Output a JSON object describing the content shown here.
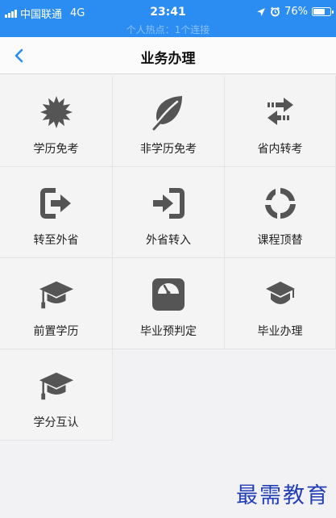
{
  "status": {
    "carrier": "中国联通",
    "network": "4G",
    "time": "23:41",
    "battery": "76%",
    "battery_level": 0.76,
    "hotspot": "个人热点：1个连接"
  },
  "nav": {
    "title": "业务办理"
  },
  "grid": {
    "items": [
      {
        "label": "学历免考",
        "icon": "starburst-icon"
      },
      {
        "label": "非学历免考",
        "icon": "leaf-icon"
      },
      {
        "label": "省内转考",
        "icon": "swap-arrows-icon"
      },
      {
        "label": "转至外省",
        "icon": "exit-icon"
      },
      {
        "label": "外省转入",
        "icon": "enter-icon"
      },
      {
        "label": "课程顶替",
        "icon": "refresh-icon"
      },
      {
        "label": "前置学历",
        "icon": "graduation-cap-icon"
      },
      {
        "label": "毕业预判定",
        "icon": "scale-icon"
      },
      {
        "label": "毕业办理",
        "icon": "graduation-cap-shield-icon"
      },
      {
        "label": "学分互认",
        "icon": "graduation-cap-icon"
      }
    ]
  },
  "watermark": "最需教育",
  "colors": {
    "statusbar": "#2b8cf2",
    "accent": "#2b8cf2",
    "icon": "#555555",
    "watermark": "#233fb8"
  }
}
